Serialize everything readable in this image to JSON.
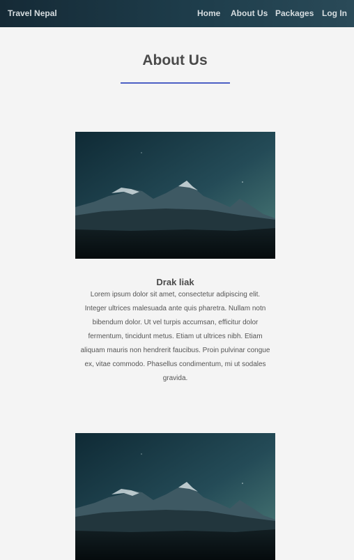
{
  "navbar": {
    "brand": "Travel Nepal",
    "links": [
      {
        "label": "Home"
      },
      {
        "label": "About Us"
      },
      {
        "label": "Packages"
      },
      {
        "label": "Log In"
      }
    ]
  },
  "main": {
    "title": "About Us",
    "accent_color": "#4b5fc4",
    "cards": [
      {
        "image": "mountain-landscape-image",
        "name": "Drak liak",
        "description": "Lorem ipsum dolor sit amet, consectetur adipiscing elit. Integer ultrices malesuada ante quis pharetra. Nullam notn bibendum dolor. Ut vel turpis accumsan, efficitur dolor fermentum, tincidunt metus. Etiam ut ultrices nibh. Etiam aliquam mauris non hendrerit faucibus. Proin pulvinar congue ex, vitae commodo. Phasellus condimentum, mi ut sodales gravida."
      },
      {
        "image": "mountain-landscape-image"
      }
    ]
  }
}
